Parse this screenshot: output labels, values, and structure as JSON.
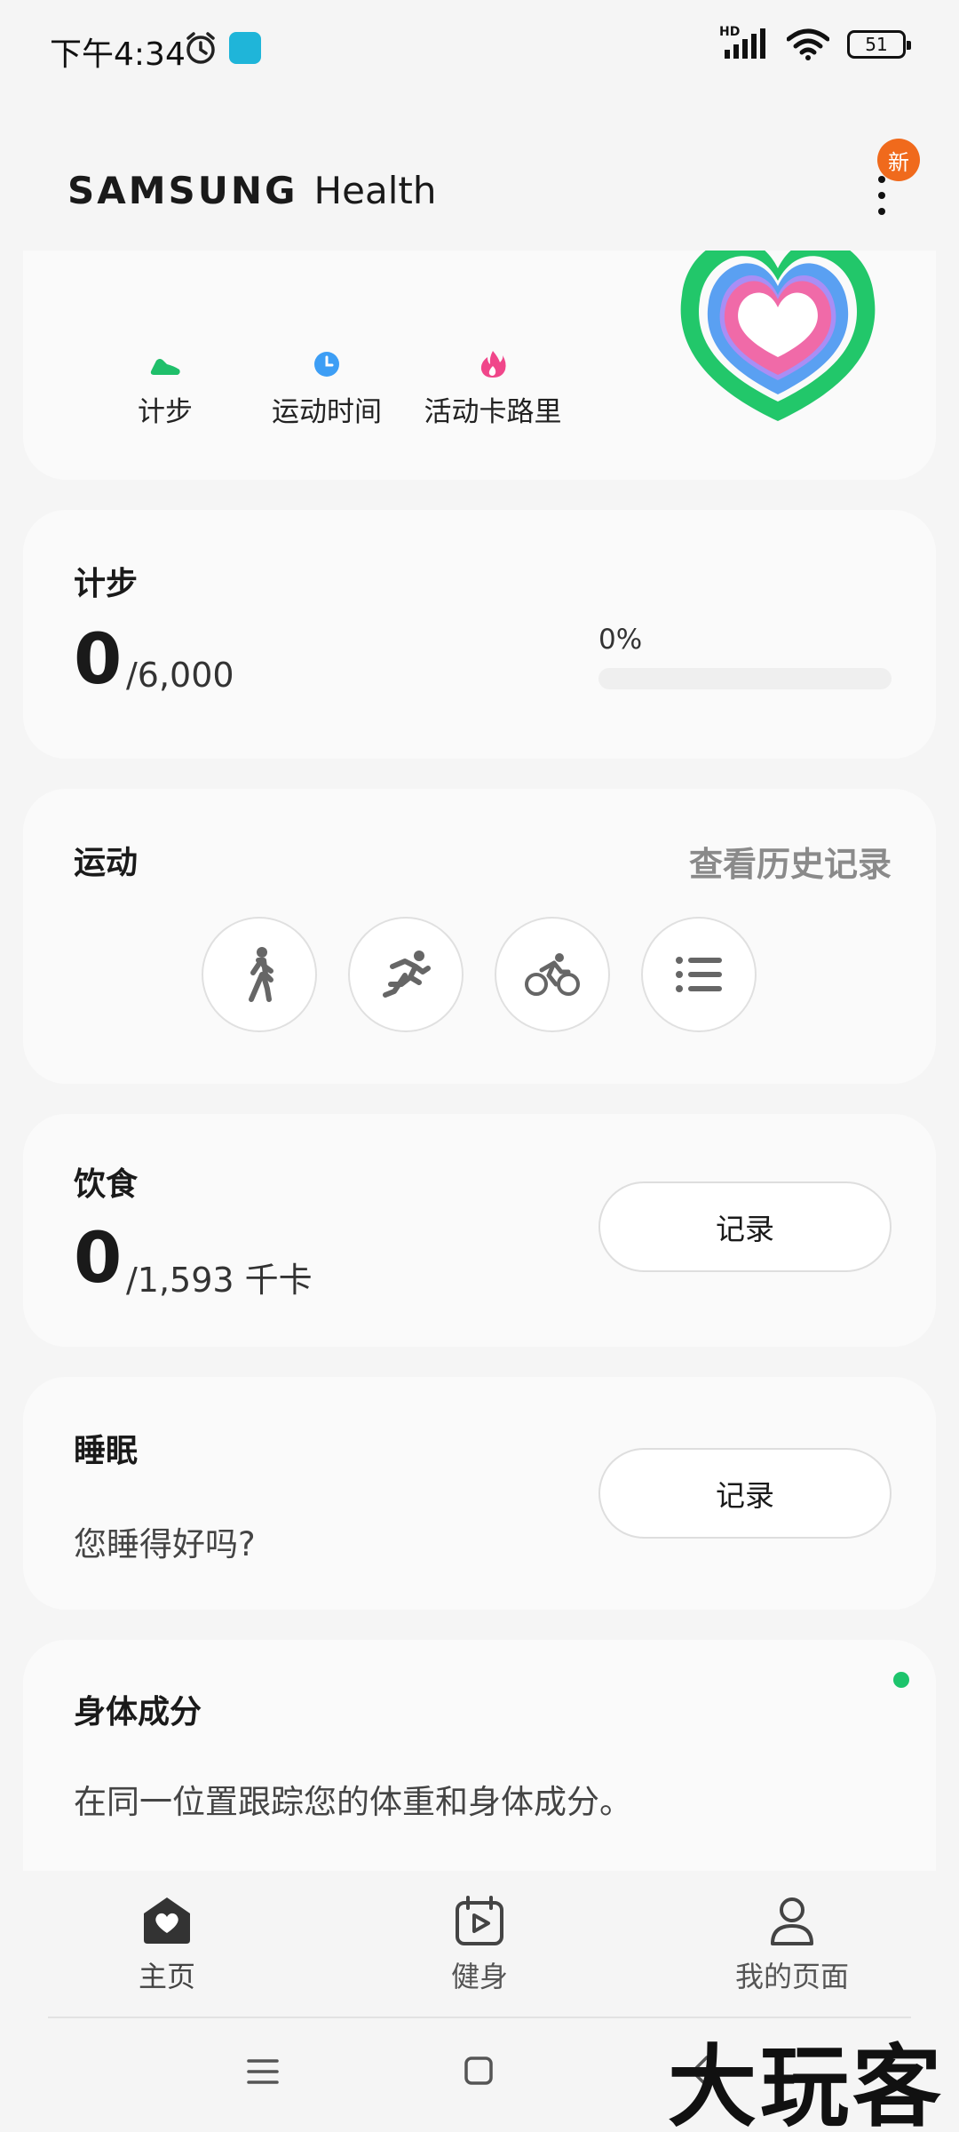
{
  "status_bar": {
    "time": "下午4:34",
    "network_label": "HD",
    "battery": "51"
  },
  "app_bar": {
    "logo_brand": "SAMSUNG",
    "logo_word": "Health",
    "new_badge": "新"
  },
  "summary": {
    "metrics": [
      {
        "label": "计步",
        "icon": "shoe-icon",
        "color": "#1fbf6a"
      },
      {
        "label": "运动时间",
        "icon": "clock-icon",
        "color": "#3d9ef5"
      },
      {
        "label": "活动卡路里",
        "icon": "flame-icon",
        "color": "#f0468a"
      }
    ]
  },
  "steps": {
    "title": "计步",
    "value": "0",
    "goal": "/6,000",
    "percent_label": "0%",
    "progress": 0
  },
  "exercise": {
    "title": "运动",
    "history_link": "查看历史记录",
    "buttons": [
      "walk-icon",
      "run-icon",
      "cycle-icon",
      "list-icon"
    ]
  },
  "food": {
    "title": "饮食",
    "value": "0",
    "goal": "/1,593 千卡",
    "record_label": "记录"
  },
  "sleep": {
    "title": "睡眠",
    "question": "您睡得好吗?",
    "record_label": "记录"
  },
  "body": {
    "title": "身体成分",
    "description": "在同一位置跟踪您的体重和身体成分。"
  },
  "bottom_nav": [
    {
      "label": "主页",
      "icon": "home-heart-icon",
      "active": true
    },
    {
      "label": "健身",
      "icon": "calendar-play-icon",
      "active": false
    },
    {
      "label": "我的页面",
      "icon": "person-icon",
      "active": false
    }
  ],
  "watermark": "大玩客"
}
